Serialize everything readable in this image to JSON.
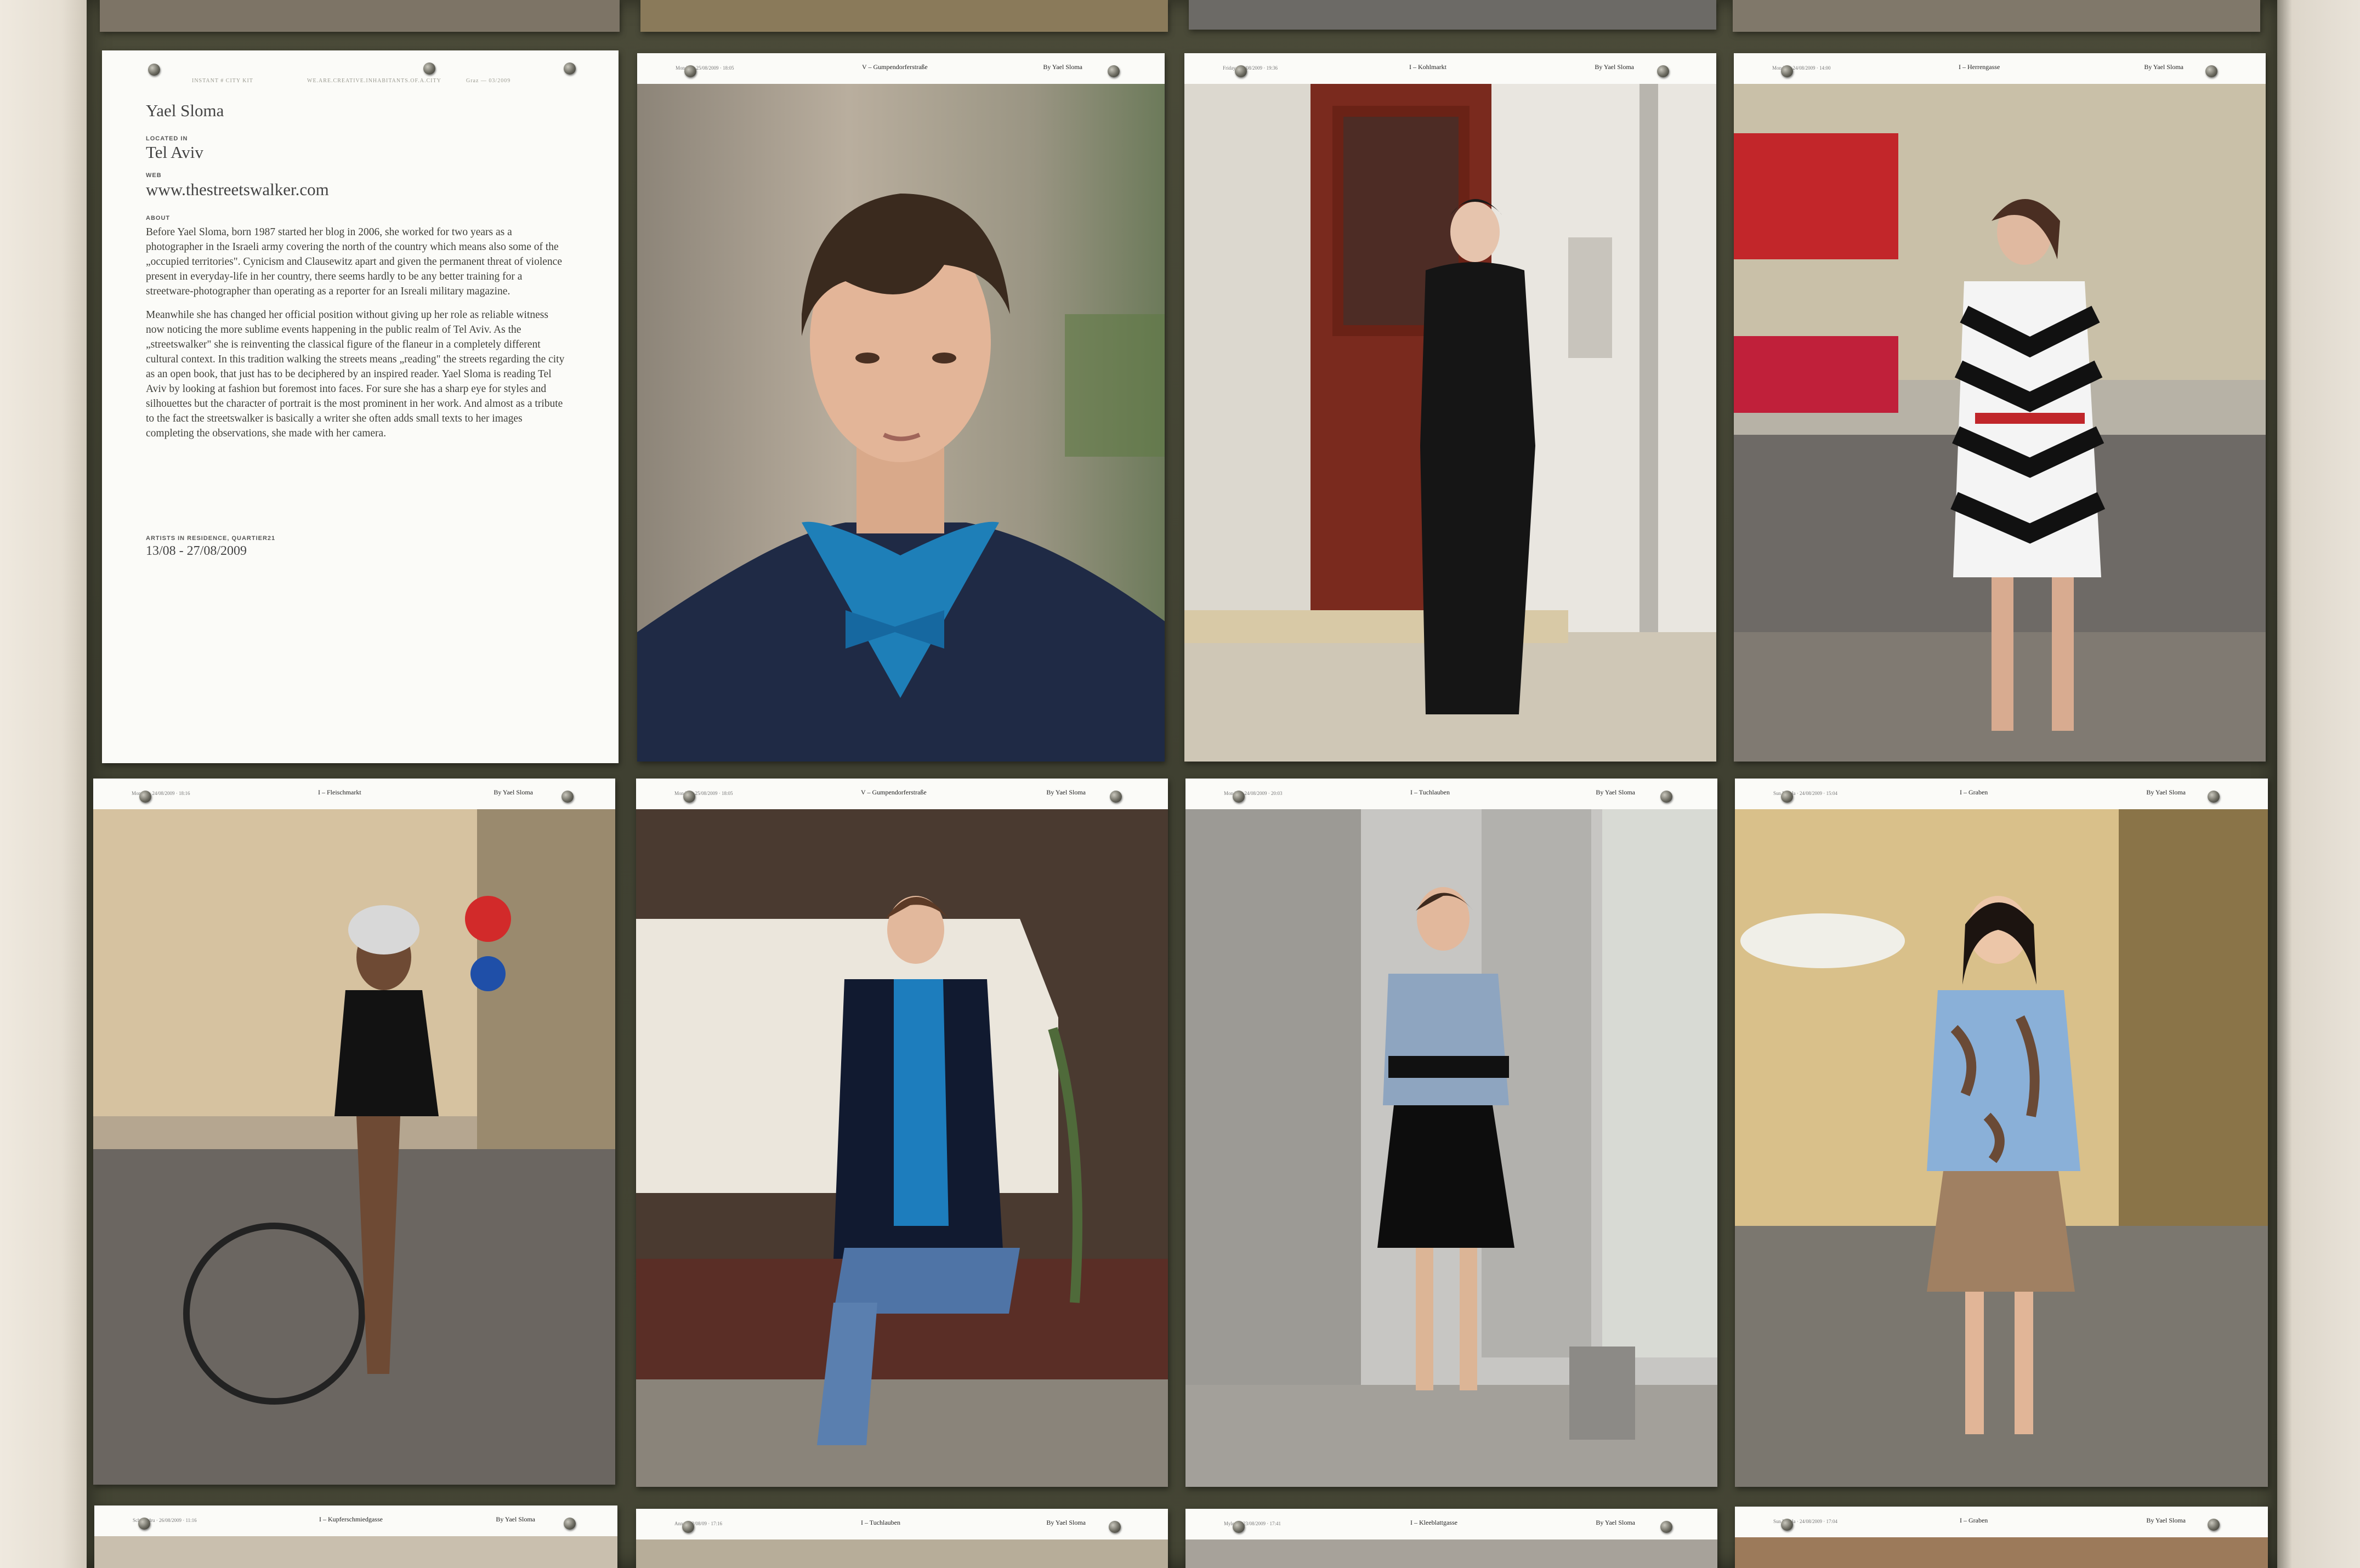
{
  "artist_sheet": {
    "header_left": "INSTANT # CITY KIT",
    "header_mid": "WE.ARE.CREATIVE.INHABITANTS.OF.A.CITY",
    "header_right": "Graz — 03/2009",
    "name": "Yael Sloma",
    "located_label": "LOCATED IN",
    "located_value": "Tel Aviv",
    "web_label": "WEB",
    "web_value": "www.thestreetswalker.com",
    "about_label": "ABOUT",
    "about_p1": "Before Yael Sloma, born 1987 started her blog in 2006, she worked for two years as a photographer in the Israeli army covering the north of the country which means also some of the „occupied territories\". Cynicism and Clausewitz apart and given the permanent threat of violence present in everyday-life in her country, there seems hardly to be any better training for a streetware-photographer than operating as a reporter for an Isreali military magazine.",
    "about_p2": "Meanwhile she has changed her official position without giving up her role as reliable witness now noticing the more sublime events happening in the public realm of Tel Aviv. As the „streetswalker\" she is reinventing the classical figure of the flaneur in a completely different cultural context. In this tradition walking the streets means „reading\" the streets regarding the city as an open book, that just has to be deciphered by an inspired reader. Yael Sloma is reading Tel Aviv by looking at fashion but foremost into faces. For sure she has a sharp eye for styles and silhouettes but the character of portrait is the most prominent in her work. And almost as a tribute to the fact the streetswalker is basically a writer she often adds small texts to her images completing the observations, she made with her camera.",
    "residence_label": "ARTISTS IN RESIDENCE, QUARTIER21",
    "residence_dates": "13/08 - 27/08/2009"
  },
  "photo_sheets": [
    {
      "id": "r1c2",
      "date": "Monday · 25/08/2009 · 18:05",
      "place": "V – Gumpendorferstraße",
      "byline": "By Yael Sloma",
      "subject": "close-up portrait, blue shirt and bow tie"
    },
    {
      "id": "r1c3",
      "date": "Friday · 21/08/2009 · 19:36",
      "place": "I – Kohlmarkt",
      "byline": "By Yael Sloma",
      "subject": "man in black at red door"
    },
    {
      "id": "r1c4",
      "date": "Monday · 24/08/2009 · 14:00",
      "place": "I – Herrengasse",
      "byline": "By Yael Sloma",
      "subject": "woman in zig-zag dress"
    },
    {
      "id": "r2c1",
      "date": "Monday · 24/08/2009 · 18:16",
      "place": "I – Fleischmarkt",
      "byline": "By Yael Sloma",
      "subject": "cyclist with helmet"
    },
    {
      "id": "r2c2",
      "date": "Monday · 25/08/2009 · 18:05",
      "place": "V – Gumpendorferstraße",
      "byline": "By Yael Sloma",
      "subject": "seated person in blue suit"
    },
    {
      "id": "r2c3",
      "date": "Monday · 24/08/2009 · 20:03",
      "place": "I – Tuchlauben",
      "byline": "By Yael Sloma",
      "subject": "woman in patterned top"
    },
    {
      "id": "r2c4",
      "date": "Sun Mei Ja · 24/08/2009 · 15:04",
      "place": "I – Graben",
      "byline": "By Yael Sloma",
      "subject": "smiling woman in floral blouse"
    },
    {
      "id": "r3c1",
      "date": "Schwandru · 26/08/2009 · 11:16",
      "place": "I – Kupferschmiedgasse",
      "byline": "By Yael Sloma"
    },
    {
      "id": "r3c2",
      "date": "Anna · 22/08/09 · 17:16",
      "place": "I – Tuchlauben",
      "byline": "By Yael Sloma"
    },
    {
      "id": "r3c3",
      "date": "Mylene · 23/08/2009 · 17:41",
      "place": "I – Kleeblattgasse",
      "byline": "By Yael Sloma"
    },
    {
      "id": "r3c4",
      "date": "Sun Mei Ja · 24/08/2009 · 17:04",
      "place": "I – Graben",
      "byline": "By Yael Sloma"
    }
  ]
}
